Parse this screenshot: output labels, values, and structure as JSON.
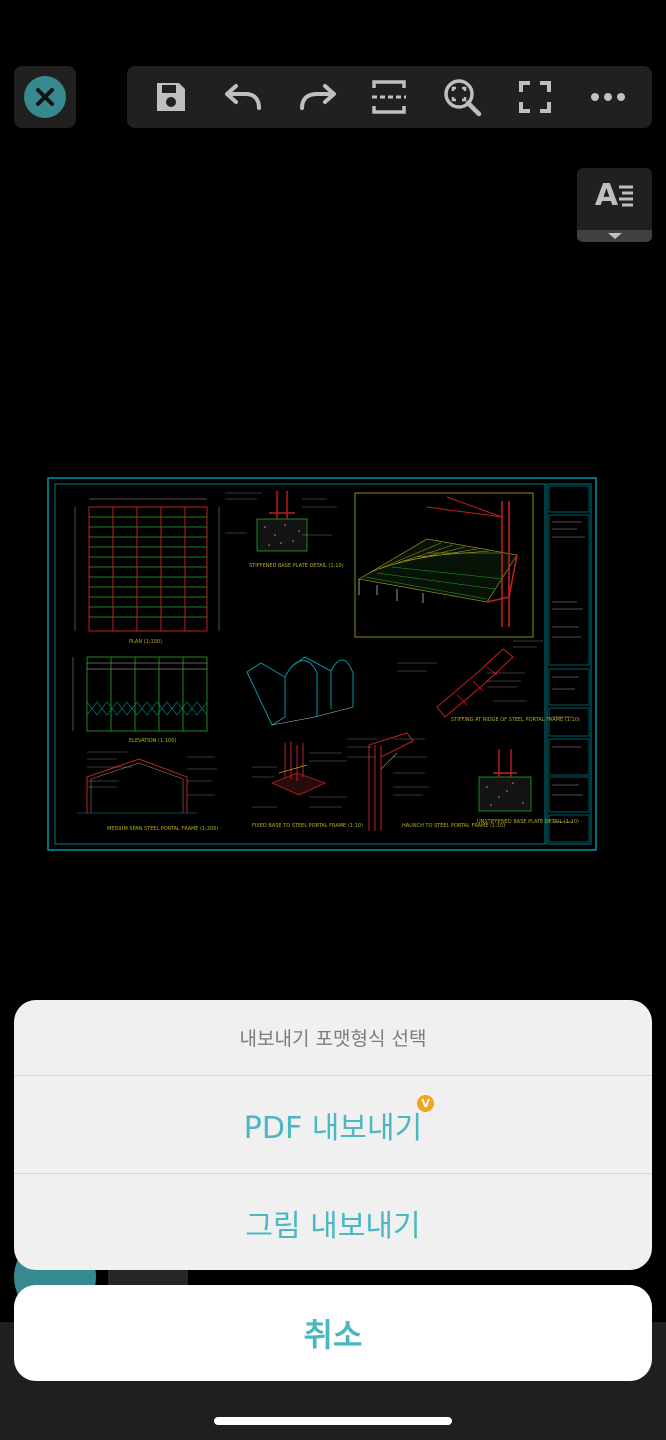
{
  "toolbar": {
    "close": "close-icon",
    "tools": [
      "save-icon",
      "undo-icon",
      "redo-icon",
      "capture-area-icon",
      "zoom-window-icon",
      "fullscreen-icon",
      "more-icon"
    ]
  },
  "text_style_button": {
    "label": "A",
    "icon": "text-style-icon"
  },
  "drawing": {
    "labels": {
      "plan": "PLAN (1:100)",
      "elevation": "ELEVATION (1:100)",
      "stiffened": "STIFFENED BASE PLATE DETAIL (1:10)",
      "stiffing": "STIFFING AT RIDGE OF STEEL PORTAL FRAME (1:10)",
      "medium": "MEDIUM SPAN STEEL PORTAL FRAME (1:200)",
      "fixed": "FIXED BASE TO STEEL PORTAL FRAME (1:10)",
      "haunch": "HAUNCH TO STEEL PORTAL FRAME (1:10)",
      "unstiffened": "UNSTIFFENED BASE PLATE DETAIL (1:10)"
    }
  },
  "export_sheet": {
    "title": "내보내기 포맷형식 선택",
    "pdf_label": "PDF 내보내기",
    "pdf_badge": "V",
    "image_label": "그림 내보내기"
  },
  "cancel_label": "취소",
  "colors": {
    "accent": "#4ab7c1",
    "badge": "#f2a51a",
    "cad_border": "#00c8d8",
    "cad_red": "#ff2a2a",
    "cad_yellow": "#f0e020",
    "cad_green": "#30e030"
  }
}
